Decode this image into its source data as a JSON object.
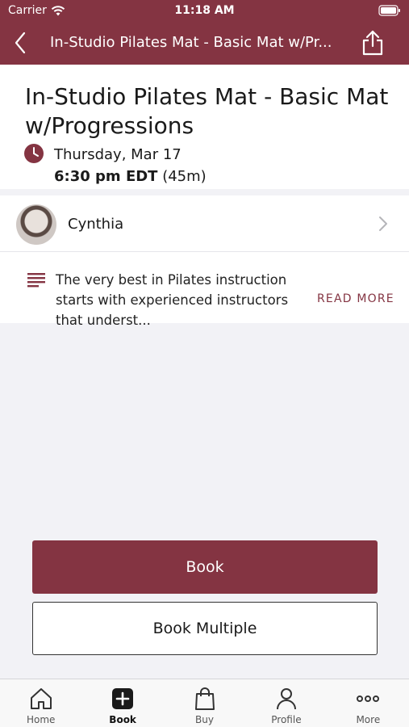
{
  "status_bar": {
    "carrier": "Carrier",
    "time": "11:18 AM"
  },
  "nav": {
    "title": "In-Studio  Pilates Mat - Basic Mat w/Pr..."
  },
  "class": {
    "title": "In-Studio  Pilates Mat - Basic Mat w/Progressions",
    "date": "Thursday, Mar 17",
    "time": "6:30 pm EDT",
    "duration": "(45m)"
  },
  "instructor": {
    "name": "Cynthia"
  },
  "description": {
    "text": "The very best in Pilates instruction starts with experienced instructors that underst...",
    "read_more": "READ MORE"
  },
  "actions": {
    "book": "Book",
    "book_multiple": "Book Multiple"
  },
  "tabs": [
    {
      "label": "Home",
      "icon": "home-icon"
    },
    {
      "label": "Book",
      "icon": "plus-square-icon"
    },
    {
      "label": "Buy",
      "icon": "shopping-bag-icon"
    },
    {
      "label": "Profile",
      "icon": "person-icon"
    },
    {
      "label": "More",
      "icon": "ellipsis-icon"
    }
  ],
  "colors": {
    "brand": "#843442",
    "background": "#f2f2f6"
  }
}
